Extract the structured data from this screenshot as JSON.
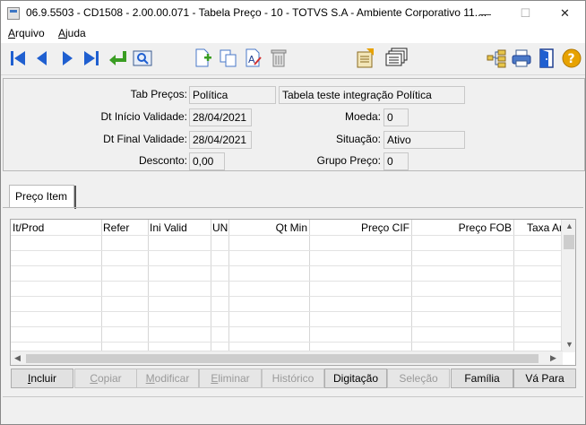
{
  "window": {
    "title": "06.9.5503 - CD1508 - 2.00.00.071 - Tabela Preço - 10 - TOTVS S.A - Ambiente Corporativo 11....",
    "minimize_glyph": "—",
    "maximize_glyph": "☐",
    "close_glyph": "✕"
  },
  "menu": {
    "items": [
      {
        "label_hotkey": "A",
        "label_rest": "rquivo"
      },
      {
        "label_hotkey": "A",
        "label_rest": "juda"
      }
    ]
  },
  "toolbar": {
    "icons": [
      "first-record-icon",
      "previous-record-icon",
      "next-record-icon",
      "last-record-icon",
      "go-to-icon",
      "search-icon",
      "new-record-icon",
      "copy-icon",
      "edit-icon",
      "delete-icon",
      "report-icon",
      "documents-icon",
      "tree-icon",
      "print-icon",
      "exit-icon",
      "help-icon"
    ],
    "accent_blue": "#1f5fd0",
    "accent_green": "#3a9d23",
    "help_color": "#e7a200"
  },
  "form": {
    "tab_precos_label": "Tab Preços:",
    "tab_precos_value": "Política",
    "tab_precos_desc": "Tabela teste integração Política",
    "dt_inicio_label": "Dt Início Validade:",
    "dt_inicio_value": "28/04/2021",
    "moeda_label": "Moeda:",
    "moeda_value": "0",
    "dt_final_label": "Dt Final Validade:",
    "dt_final_value": "28/04/2021",
    "situacao_label": "Situação:",
    "situacao_value": "Ativo",
    "desconto_label": "Desconto:",
    "desconto_value": "0,00",
    "grupo_preco_label": "Grupo Preço:",
    "grupo_preco_value": "0"
  },
  "tabs": [
    {
      "label": "Preço Item"
    }
  ],
  "grid": {
    "columns": [
      "It/Prod",
      "Refer",
      "Ini Valid",
      "UN",
      "Qt Min",
      "Preço CIF",
      "Preço FOB",
      "Taxa Ar"
    ],
    "rows": []
  },
  "buttons": [
    {
      "hotkey": "I",
      "rest": "ncluir",
      "enabled": true
    },
    {
      "hotkey": "C",
      "rest": "opiar",
      "enabled": false
    },
    {
      "hotkey": "M",
      "rest": "odificar",
      "enabled": false
    },
    {
      "hotkey": "E",
      "rest": "liminar",
      "enabled": false
    },
    {
      "hotkey": "",
      "rest": "Histórico",
      "enabled": false
    },
    {
      "hotkey": "",
      "rest": "Digitação",
      "enabled": true
    },
    {
      "hotkey": "",
      "rest": "Seleção",
      "enabled": false
    },
    {
      "hotkey": "",
      "rest": "Família",
      "enabled": true
    },
    {
      "hotkey": "",
      "rest": "Vá Para",
      "enabled": true
    }
  ]
}
